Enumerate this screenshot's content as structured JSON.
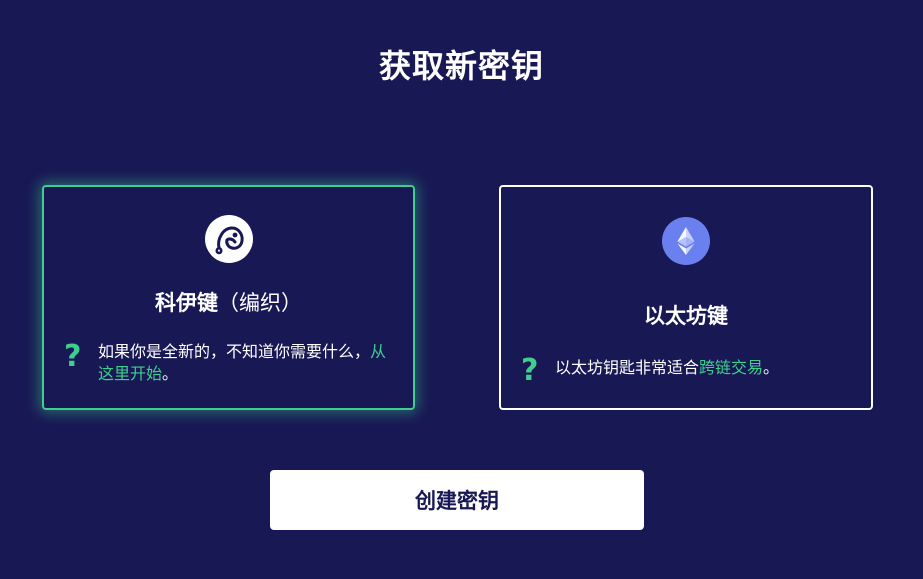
{
  "title": "获取新密钥",
  "cards": [
    {
      "icon": "cosmos-keplr-icon",
      "title": "科伊键",
      "subtitle": "（编织）",
      "help_text_before": "如果你是全新的，不知道你需要什么，",
      "help_link": "从这里开始",
      "help_text_after": "。",
      "selected": true
    },
    {
      "icon": "ethereum-icon",
      "title": "以太坊键",
      "help_text_before": "以太坊钥匙非常适合",
      "help_link": "跨链交易",
      "help_text_after": "。",
      "selected": false
    }
  ],
  "help_icon": "question-mark-icon",
  "create_button_label": "创建密钥",
  "colors": {
    "background": "#181854",
    "accent": "#3ecf8e",
    "ethereum": "#6b80ef",
    "text": "#ffffff"
  }
}
